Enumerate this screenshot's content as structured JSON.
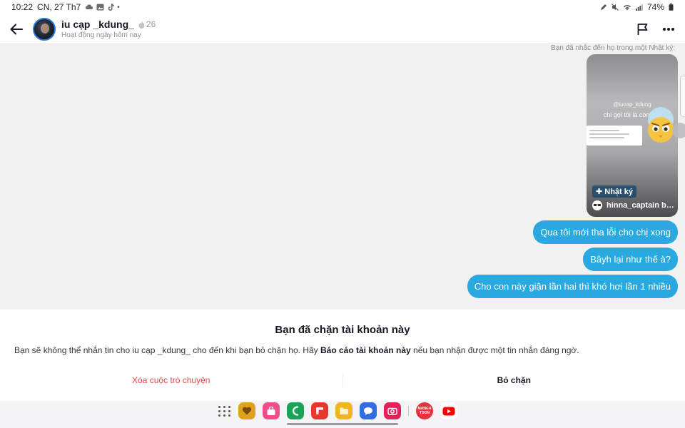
{
  "status_bar": {
    "time": "10:22",
    "date": "CN, 27 Th7",
    "notif_icons": [
      "cloud-icon",
      "gallery-icon",
      "tiktok-icon"
    ],
    "right_icons": [
      "edit-icon",
      "mute-icon",
      "wifi-icon",
      "signal-icon"
    ],
    "battery": "74%"
  },
  "header": {
    "username": "iu cạp _kdung_",
    "streak_count": "26",
    "activity": "Hoạt động ngày hôm nay"
  },
  "chat": {
    "mention_note": "Bạn đã nhắc đến họ trong một Nhật ký:",
    "story": {
      "mention": "@iucap_kdung",
      "caption": "chị gọi tôi là con SM",
      "tag": "✚ Nhật ký",
      "author": "hinna_captain bo..."
    },
    "messages": [
      "Qua tôi mới tha lỗi cho chị xong",
      "Bâyh lại như thế à?",
      "Cho con này giận lần hai thì khó hơi lần 1 nhiều"
    ]
  },
  "blocked": {
    "title": "Bạn đã chặn tài khoản này",
    "desc_prefix": "Bạn sẽ không thể nhắn tin cho iu cạp _kdung_ cho đến khi bạn bỏ chặn họ. Hãy ",
    "desc_link": "Báo cáo tài khoản này",
    "desc_suffix": " nếu bạn nhận được một tin nhắn đáng ngờ.",
    "delete_label": "Xóa cuộc trò chuyện",
    "unblock_label": "Bỏ chặn"
  },
  "dock": {
    "manga_label": "MANGA TOON",
    "colors": {
      "heart_app": "#e0a21a",
      "shop_app": "#f24d8a",
      "phone_app": "#1aa35a",
      "flipboard_app": "#e5392b",
      "folder_app": "#f0b41c",
      "messages_app": "#2f6de0",
      "camera_app": "#e2235a",
      "manga_app": "#e7323c",
      "youtube_app": "#ff0000"
    }
  },
  "theme": {
    "bubble_color": "#2aa8e0",
    "danger_color": "#e8454d"
  }
}
